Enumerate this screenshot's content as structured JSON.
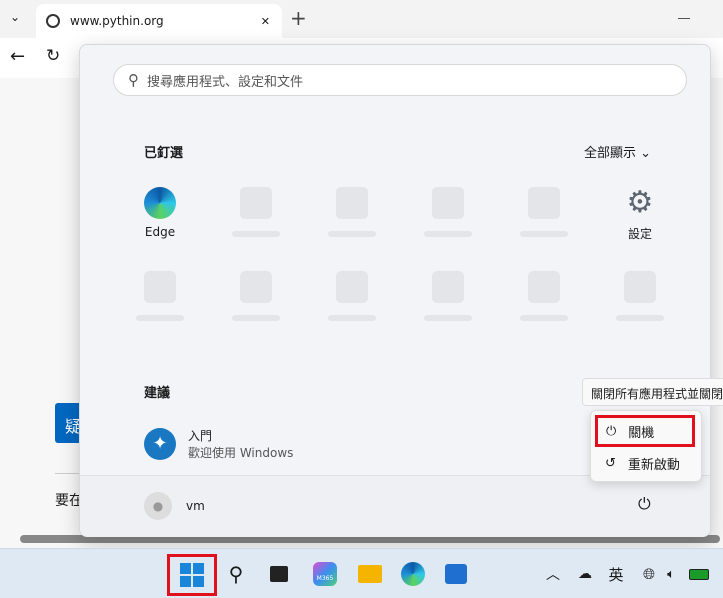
{
  "browser": {
    "tab_title": "www.pythin.org",
    "new_tab": "+",
    "close": "✕",
    "page_button_label": "疑",
    "page_text": "要在"
  },
  "start_menu": {
    "search_placeholder": "搜尋應用程式、設定和文件",
    "pinned_title": "已釘選",
    "show_all": "全部顯示",
    "pinned_apps": [
      {
        "label": "Edge"
      },
      {
        "label": "設定"
      }
    ],
    "recommended_title": "建議",
    "recommended": [
      {
        "title": "入門",
        "subtitle": "歡迎使用 Windows"
      }
    ],
    "user": "vm"
  },
  "power_menu": {
    "tooltip": "關閉所有應用程式並關閉",
    "items": [
      {
        "label": "關機"
      },
      {
        "label": "重新啟動"
      }
    ]
  },
  "taskbar": {
    "ime": "英",
    "m365_badge": "M365"
  },
  "colors": {
    "highlight": "#e0101c",
    "accent": "#0067c0"
  }
}
